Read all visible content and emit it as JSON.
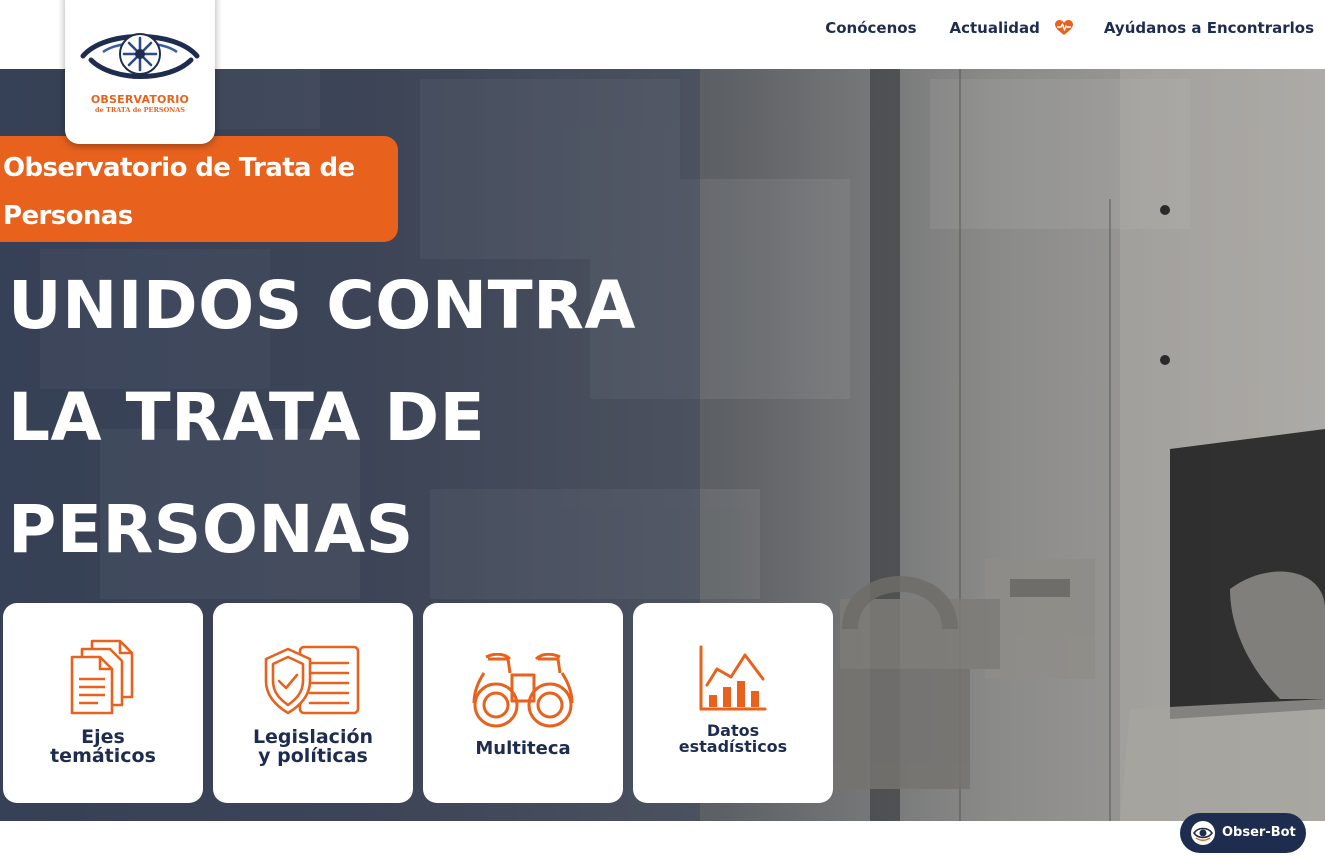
{
  "nav": {
    "items": [
      "Conócenos",
      "Actualidad",
      "Ayúdanos a Encontrarlos"
    ]
  },
  "logo": {
    "title": "OBSERVATORIO",
    "subtitle": "de TRATA de PERSONAS"
  },
  "hero": {
    "badge": "Observatorio de Trata de Personas",
    "headline": "UNIDOS CONTRA LA TRATA DE PERSONAS"
  },
  "cards": [
    {
      "line1": "Ejes",
      "line2": "temáticos",
      "icon": "documents-icon"
    },
    {
      "line1": "Legislación",
      "line2": "y políticas",
      "icon": "shield-checklist-icon"
    },
    {
      "line1": "Multiteca",
      "line2": "",
      "icon": "binoculars-icon"
    },
    {
      "line1": "Datos",
      "line2": "estadísticos",
      "icon": "bar-chart-icon"
    }
  ],
  "chatbot": {
    "label": "Obser-Bot"
  },
  "colors": {
    "accent": "#e8621e",
    "navy": "#1e2d4f"
  }
}
